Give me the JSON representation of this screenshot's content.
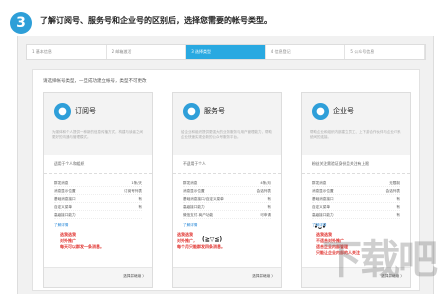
{
  "header": {
    "step_number": "3",
    "title": "了解订阅号、服务号和企业号的区别后，选择您需要的帐号类型。"
  },
  "steps": [
    "1 基本信息",
    "2 邮箱激活",
    "3 选择类型",
    "4 信息登记",
    "5 公众号信息"
  ],
  "active_step": 2,
  "main": {
    "hint": "请选择帐号类型，一旦成功建立帐号，类型不可更改"
  },
  "cards": [
    {
      "title": "订阅号",
      "icon": "speech-bubble-icon",
      "desc": "为媒体和个人提供一种新的信息传播方式，构建与读者之间更好的沟通与管理模式。",
      "who": "适用于个人和组织",
      "rows": [
        [
          "群发消息",
          "1条/天"
        ],
        [
          "消息显示位置",
          "订阅号列表"
        ],
        [
          "基础消息接口",
          "有"
        ],
        [
          "自定义菜单",
          "有"
        ],
        [
          "高级接口能力",
          ""
        ]
      ],
      "more": "了解详情",
      "select": "选择并继续 〉",
      "notes": [
        "选我选我",
        "对外推广",
        "每天可以群发一条消息。"
      ]
    },
    {
      "title": "服务号",
      "icon": "person-icon",
      "desc": "给企业和组织提供更强大的业务服务与用户管理能力，帮助企业快速实现全新的公众号服务平台。",
      "who": "不适用于个人",
      "rows": [
        [
          "群发消息",
          "4条/月"
        ],
        [
          "消息显示位置",
          "会话列表"
        ],
        [
          "基础消息接口/自定义菜单",
          "有"
        ],
        [
          "高级接口能力",
          "有"
        ],
        [
          "微信支付-商户功能",
          "可申请"
        ]
      ],
      "more": "了解详情",
      "select": "选择并继续 〉",
      "notes": [
        "选我选我",
        "对外推广，",
        "每个月只能群发四条消息。"
      ]
    },
    {
      "title": "企业号",
      "icon": "globe-icon",
      "desc": "帮助企业和组织内部建立员工、上下游合作伙伴与企业IT系统间的连接。",
      "who": "粉丝关注需验证身份且关注有上限",
      "rows": [
        [
          "群发消息",
          "无限制"
        ],
        [
          "消息显示位置",
          "会话列表"
        ],
        [
          "基础消息接口",
          "有"
        ],
        [
          "自定义菜单",
          "有"
        ],
        [
          "高级接口能力",
          "有"
        ]
      ],
      "more": "了解详情",
      "select": "选择并继续 〉",
      "notes": [
        "选我选我",
        "不适合对外推广",
        "适合企业内部管理",
        "只能让企业内部的人关注"
      ]
    }
  ],
  "faces": [
    "(≧▽≦)",
    "•̀ᴗ•́"
  ],
  "watermark": "下载吧"
}
